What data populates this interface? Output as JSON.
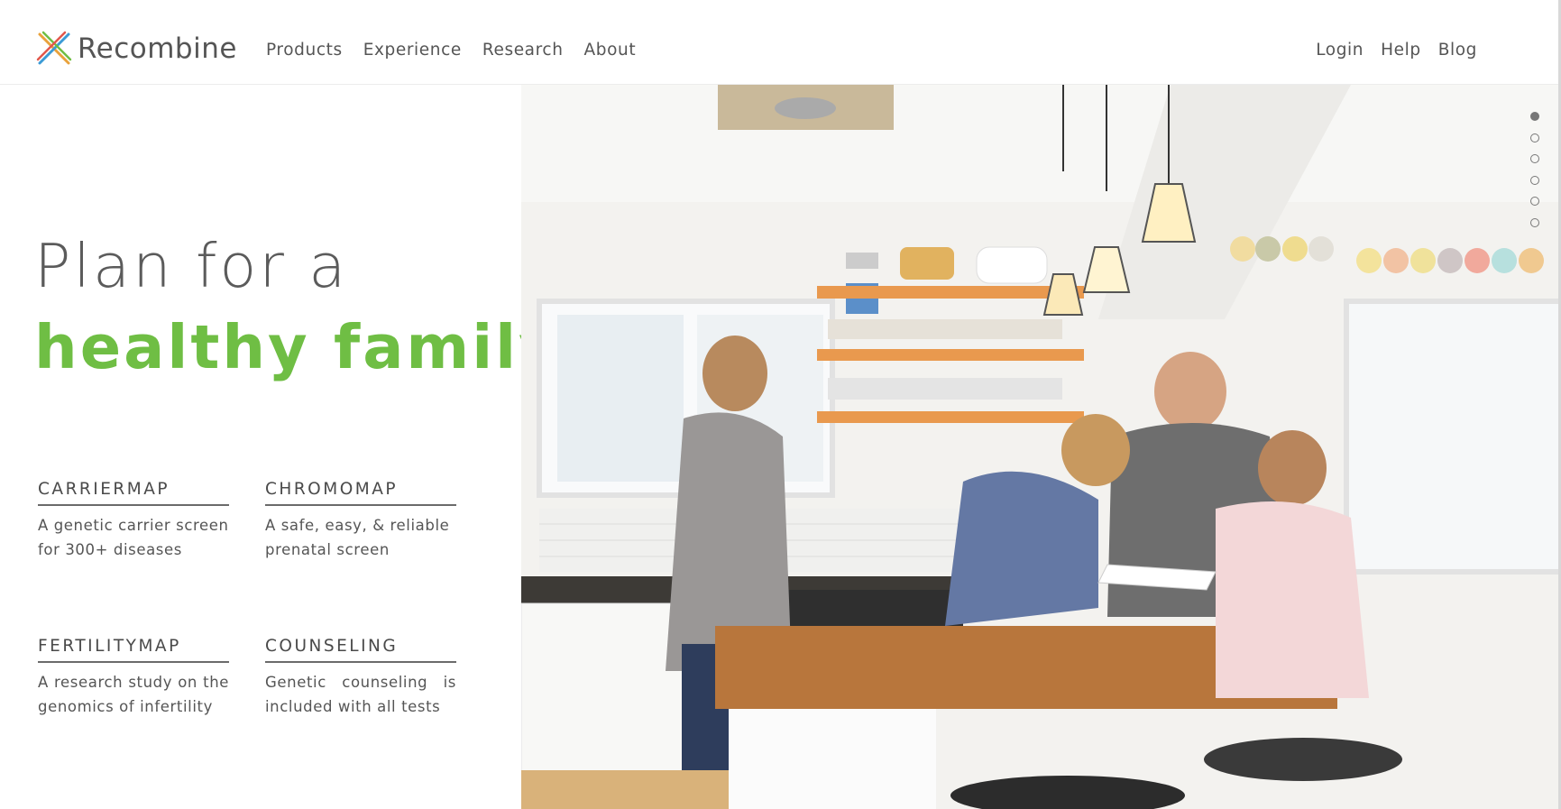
{
  "brand": {
    "name": "Recombine",
    "logo_colors": [
      "#e9a23b",
      "#6fbe44",
      "#3b9bd6",
      "#e2574c"
    ]
  },
  "nav": {
    "left": [
      {
        "label": "Products"
      },
      {
        "label": "Experience"
      },
      {
        "label": "Research"
      },
      {
        "label": "About"
      }
    ],
    "right": [
      {
        "label": "Login"
      },
      {
        "label": "Help"
      },
      {
        "label": "Blog"
      }
    ]
  },
  "hero": {
    "headline_line1": "Plan for a",
    "headline_line2": "healthy family",
    "accent_color": "#6fbe44",
    "photo_icon": "family-kitchen-photo"
  },
  "products": [
    {
      "title": "CARRIERMAP",
      "desc": "A genetic carrier screen for 300+ diseases"
    },
    {
      "title": "CHROMOMAP",
      "desc": "A safe, easy, & reliable prenatal screen"
    },
    {
      "title": "FERTILITYMAP",
      "desc": "A research study on the genomics of infertility"
    },
    {
      "title": "COUNSELING",
      "desc": "Genetic counseling is included with all tests"
    }
  ],
  "carousel": {
    "slide_count": 6,
    "active_index": 0
  }
}
